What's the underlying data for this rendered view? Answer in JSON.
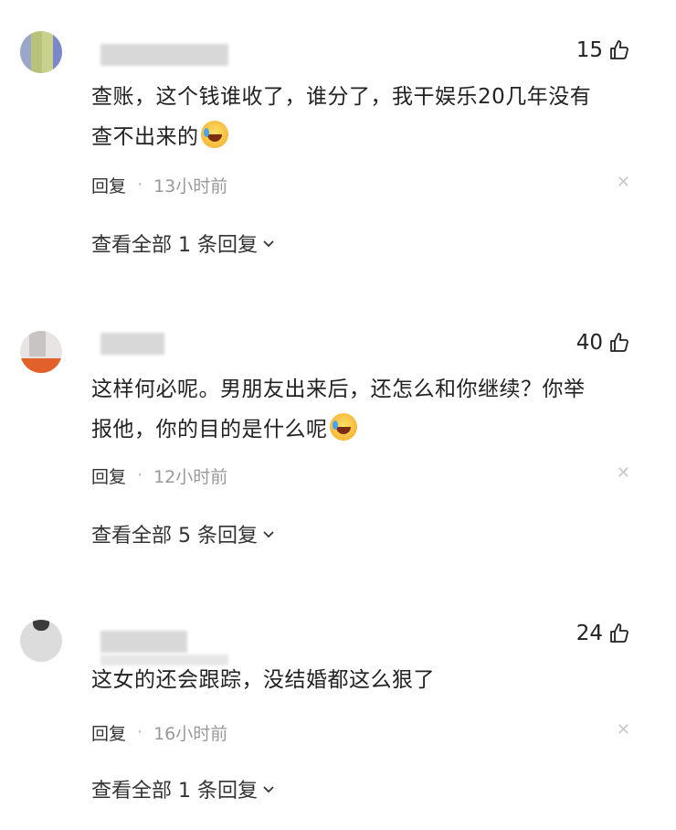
{
  "comments": [
    {
      "likes": "15",
      "lines": [
        "查账，这个钱谁收了，谁分了，我干娱乐20几年没有",
        "查不出来的"
      ],
      "reply_label": "回复",
      "separator": "·",
      "time": "13小时前",
      "view_all": "查看全部 1 条回复"
    },
    {
      "likes": "40",
      "lines": [
        "这样何必呢。男朋友出来后，还怎么和你继续？你举",
        "报他，你的目的是什么呢"
      ],
      "reply_label": "回复",
      "separator": "·",
      "time": "12小时前",
      "view_all": "查看全部 5 条回复"
    },
    {
      "likes": "24",
      "lines": [
        "这女的还会跟踪，没结婚都这么狠了"
      ],
      "reply_label": "回复",
      "separator": "·",
      "time": "16小时前",
      "view_all": "查看全部 1 条回复"
    }
  ],
  "icons": {
    "like": "thumbs-up-icon",
    "close": "close-icon",
    "chevron": "chevron-down-icon",
    "emoji": "laughing-crying-emoji-icon"
  },
  "colors": {
    "text": "#222222",
    "meta": "#999999",
    "close": "#c8c8c8"
  }
}
